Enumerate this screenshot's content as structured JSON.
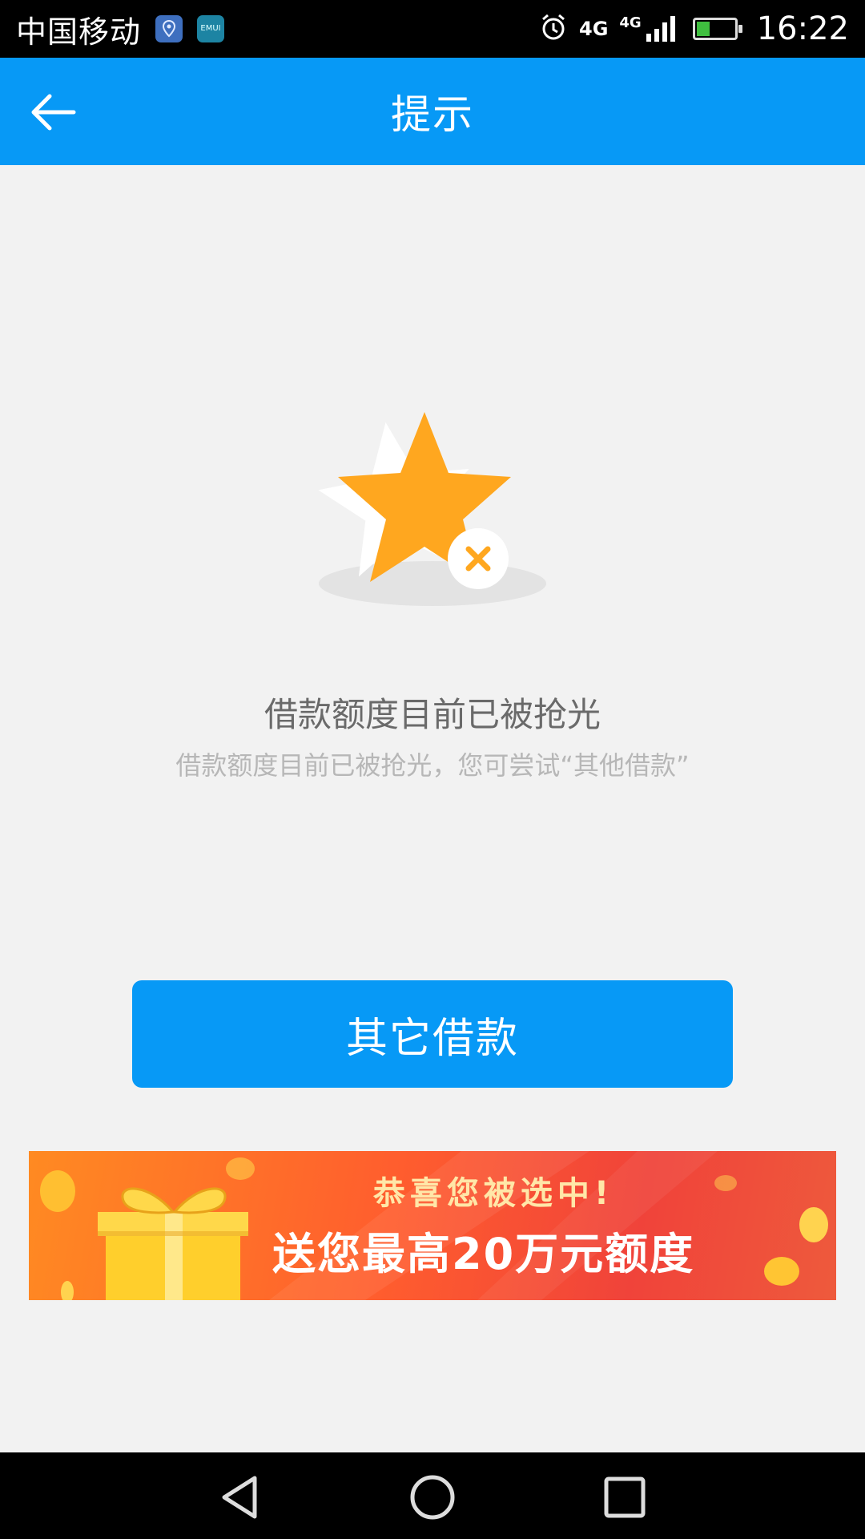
{
  "status_bar": {
    "carrier": "中国移动",
    "emui_label": "EMUI",
    "network_1": "4G",
    "network_2": "4G",
    "time": "16:22"
  },
  "header": {
    "title": "提示",
    "back_icon": "arrow-left-icon"
  },
  "illustration": {
    "icon": "star-with-x-icon",
    "colors": {
      "star": "#ffa71f",
      "badge": "#ffffff",
      "x": "#ffa71f",
      "shadow": "#e3e3e3"
    }
  },
  "message": {
    "title": "借款额度目前已被抢光",
    "subtitle": "借款额度目前已被抢光，您可尝试“其他借款”"
  },
  "primary_button": {
    "label": "其它借款"
  },
  "banner": {
    "line1": "恭喜您被选中!",
    "line2": "送您最高20万元额度"
  },
  "nav_bar": {
    "icons": [
      "back-triangle-icon",
      "home-circle-icon",
      "recents-square-icon"
    ]
  },
  "colors": {
    "accent": "#0799f6",
    "background": "#f2f2f2"
  }
}
